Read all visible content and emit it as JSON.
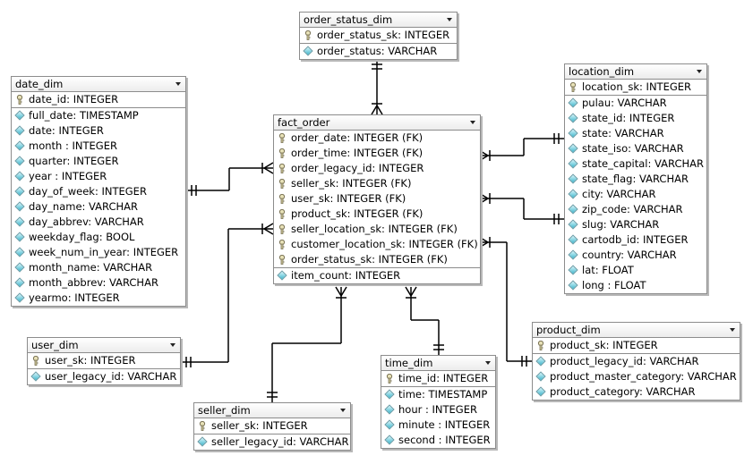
{
  "diagram": {
    "type": "ER diagram (star schema)",
    "entities": {
      "order_status_dim": {
        "name": "order_status_dim",
        "keys": [
          "order_status_sk: INTEGER"
        ],
        "attributes": [
          "order_status: VARCHAR"
        ]
      },
      "date_dim": {
        "name": "date_dim",
        "keys": [
          "date_id: INTEGER"
        ],
        "attributes": [
          "full_date: TIMESTAMP",
          "date: INTEGER",
          "month : INTEGER",
          "quarter: INTEGER",
          "year : INTEGER",
          "day_of_week: INTEGER",
          "day_name: VARCHAR",
          "day_abbrev: VARCHAR",
          "weekday_flag: BOOL",
          "week_num_in_year: INTEGER",
          "month_name: VARCHAR",
          "month_abbrev: VARCHAR",
          "yearmo: INTEGER"
        ]
      },
      "fact_order": {
        "name": "fact_order",
        "keys": [
          "order_date: INTEGER (FK)",
          "order_time: INTEGER (FK)",
          "order_legacy_id: INTEGER",
          "seller_sk: INTEGER (FK)",
          "user_sk: INTEGER (FK)",
          "product_sk: INTEGER (FK)",
          "seller_location_sk: INTEGER (FK)",
          "customer_location_sk: INTEGER (FK)",
          "order_status_sk: INTEGER (FK)"
        ],
        "attributes": [
          "item_count: INTEGER"
        ]
      },
      "location_dim": {
        "name": "location_dim",
        "keys": [
          "location_sk: INTEGER"
        ],
        "attributes": [
          "pulau: VARCHAR",
          "state_id: INTEGER",
          "state: VARCHAR",
          "state_iso: VARCHAR",
          "state_capital: VARCHAR",
          "state_flag: VARCHAR",
          "city: VARCHAR",
          "zip_code: VARCHAR",
          "slug: VARCHAR",
          "cartodb_id: INTEGER",
          "country: VARCHAR",
          "lat: FLOAT",
          "long : FLOAT"
        ]
      },
      "user_dim": {
        "name": "user_dim",
        "keys": [
          "user_sk: INTEGER"
        ],
        "attributes": [
          "user_legacy_id: VARCHAR"
        ]
      },
      "seller_dim": {
        "name": "seller_dim",
        "keys": [
          "seller_sk: INTEGER"
        ],
        "attributes": [
          "seller_legacy_id: VARCHAR"
        ]
      },
      "time_dim": {
        "name": "time_dim",
        "keys": [
          "time_id: INTEGER"
        ],
        "attributes": [
          "time: TIMESTAMP",
          "hour : INTEGER",
          "minute : INTEGER",
          "second : INTEGER"
        ]
      },
      "product_dim": {
        "name": "product_dim",
        "keys": [
          "product_sk: INTEGER"
        ],
        "attributes": [
          "product_legacy_id: VARCHAR",
          "product_master_category: VARCHAR",
          "product_category: VARCHAR"
        ]
      }
    },
    "relationships": [
      {
        "from": "order_status_dim",
        "to": "fact_order",
        "cardinality": "one-to-many"
      },
      {
        "from": "date_dim",
        "to": "fact_order",
        "cardinality": "one-to-many"
      },
      {
        "from": "user_dim",
        "to": "fact_order",
        "cardinality": "one-to-many"
      },
      {
        "from": "seller_dim",
        "to": "fact_order",
        "cardinality": "one-to-many"
      },
      {
        "from": "time_dim",
        "to": "fact_order",
        "cardinality": "one-to-many"
      },
      {
        "from": "location_dim",
        "to": "fact_order",
        "cardinality": "one-to-many",
        "role": "seller_location_sk"
      },
      {
        "from": "location_dim",
        "to": "fact_order",
        "cardinality": "one-to-many",
        "role": "customer_location_sk"
      },
      {
        "from": "product_dim",
        "to": "fact_order",
        "cardinality": "one-to-many"
      }
    ],
    "icons": {
      "key": "key-icon",
      "attribute": "diamond-attribute-icon",
      "menu": "chevron-down-icon"
    }
  }
}
